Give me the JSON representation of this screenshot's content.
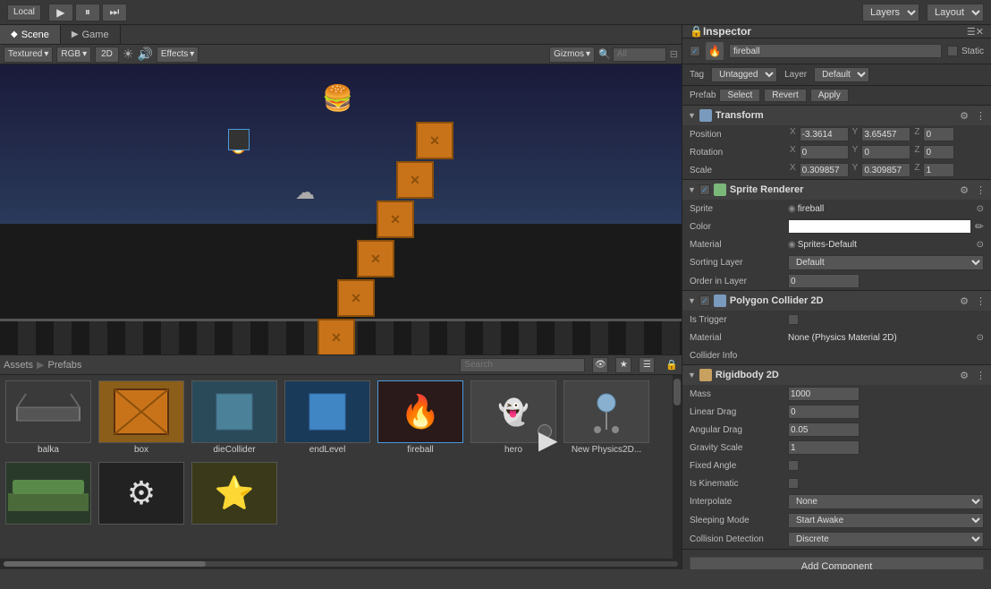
{
  "topbar": {
    "local_label": "Local",
    "layers_label": "Layers",
    "layout_label": "Layout"
  },
  "tabs": {
    "scene_label": "Scene",
    "game_label": "Game"
  },
  "scene_toolbar": {
    "textured_label": "Textured",
    "rgb_label": "RGB",
    "2d_label": "2D",
    "effects_label": "Effects",
    "gizmos_label": "Gizmos",
    "all_label": "All"
  },
  "bottom_panel": {
    "breadcrumb_assets": "Assets",
    "breadcrumb_prefabs": "Prefabs",
    "search_placeholder": "Search"
  },
  "assets": [
    {
      "id": "balka",
      "label": "balka",
      "icon": "🏗",
      "color": "#3a3a3a",
      "selected": false
    },
    {
      "id": "box",
      "label": "box",
      "icon": "📦",
      "color": "#8b5e1a",
      "selected": false
    },
    {
      "id": "diecollider",
      "label": "dieCollider",
      "icon": "💠",
      "color": "#5a9ab5",
      "selected": false
    },
    {
      "id": "endlevel",
      "label": "endLevel",
      "icon": "🔷",
      "color": "#4a9ae0",
      "selected": false
    },
    {
      "id": "fireball",
      "label": "fireball",
      "icon": "🔥",
      "color": "#c04020",
      "selected": true
    },
    {
      "id": "hero",
      "label": "hero",
      "icon": "👻",
      "color": "#666",
      "selected": false
    },
    {
      "id": "newphysics",
      "label": "New Physics2D...",
      "icon": "⚪",
      "color": "#555",
      "selected": false
    },
    {
      "id": "grass",
      "label": "",
      "icon": "🌿",
      "color": "#3a5a2a",
      "selected": false
    },
    {
      "id": "gear",
      "label": "",
      "icon": "⚙",
      "color": "#333",
      "selected": false
    },
    {
      "id": "star",
      "label": "",
      "icon": "⭐",
      "color": "#4a4a2a",
      "selected": false
    }
  ],
  "inspector": {
    "title": "Inspector",
    "object_name": "fireball",
    "static_label": "Static",
    "tag_label": "Tag",
    "tag_value": "Untagged",
    "layer_label": "Layer",
    "layer_value": "Default",
    "prefab_label": "Prefab",
    "select_btn": "Select",
    "revert_btn": "Revert",
    "apply_btn": "Apply",
    "transform": {
      "name": "Transform",
      "position_label": "Position",
      "pos_x": "-3.3614",
      "pos_y": "3.65457",
      "pos_z": "0",
      "rotation_label": "Rotation",
      "rot_x": "0",
      "rot_y": "0",
      "rot_z": "0",
      "scale_label": "Scale",
      "scale_x": "0.309857",
      "scale_y": "0.309857",
      "scale_z": "1"
    },
    "sprite_renderer": {
      "name": "Sprite Renderer",
      "sprite_label": "Sprite",
      "sprite_value": "fireball",
      "color_label": "Color",
      "material_label": "Material",
      "material_value": "Sprites-Default",
      "sorting_layer_label": "Sorting Layer",
      "sorting_layer_value": "Default",
      "order_label": "Order in Layer",
      "order_value": "0"
    },
    "polygon_collider": {
      "name": "Polygon Collider 2D",
      "is_trigger_label": "Is Trigger",
      "material_label": "Material",
      "material_value": "None (Physics Material 2D)",
      "collider_info_label": "Collider Info"
    },
    "rigidbody": {
      "name": "Rigidbody 2D",
      "mass_label": "Mass",
      "mass_value": "1000",
      "linear_drag_label": "Linear Drag",
      "linear_drag_value": "0",
      "angular_drag_label": "Angular Drag",
      "angular_drag_value": "0.05",
      "gravity_scale_label": "Gravity Scale",
      "gravity_scale_value": "1",
      "fixed_angle_label": "Fixed Angle",
      "is_kinematic_label": "Is Kinematic",
      "interpolate_label": "Interpolate",
      "interpolate_value": "None",
      "sleeping_mode_label": "Sleeping Mode",
      "sleeping_mode_value": "Start Awake",
      "collision_detection_label": "Collision Detection",
      "collision_detection_value": "Discrete"
    },
    "add_component_label": "Add Component"
  }
}
